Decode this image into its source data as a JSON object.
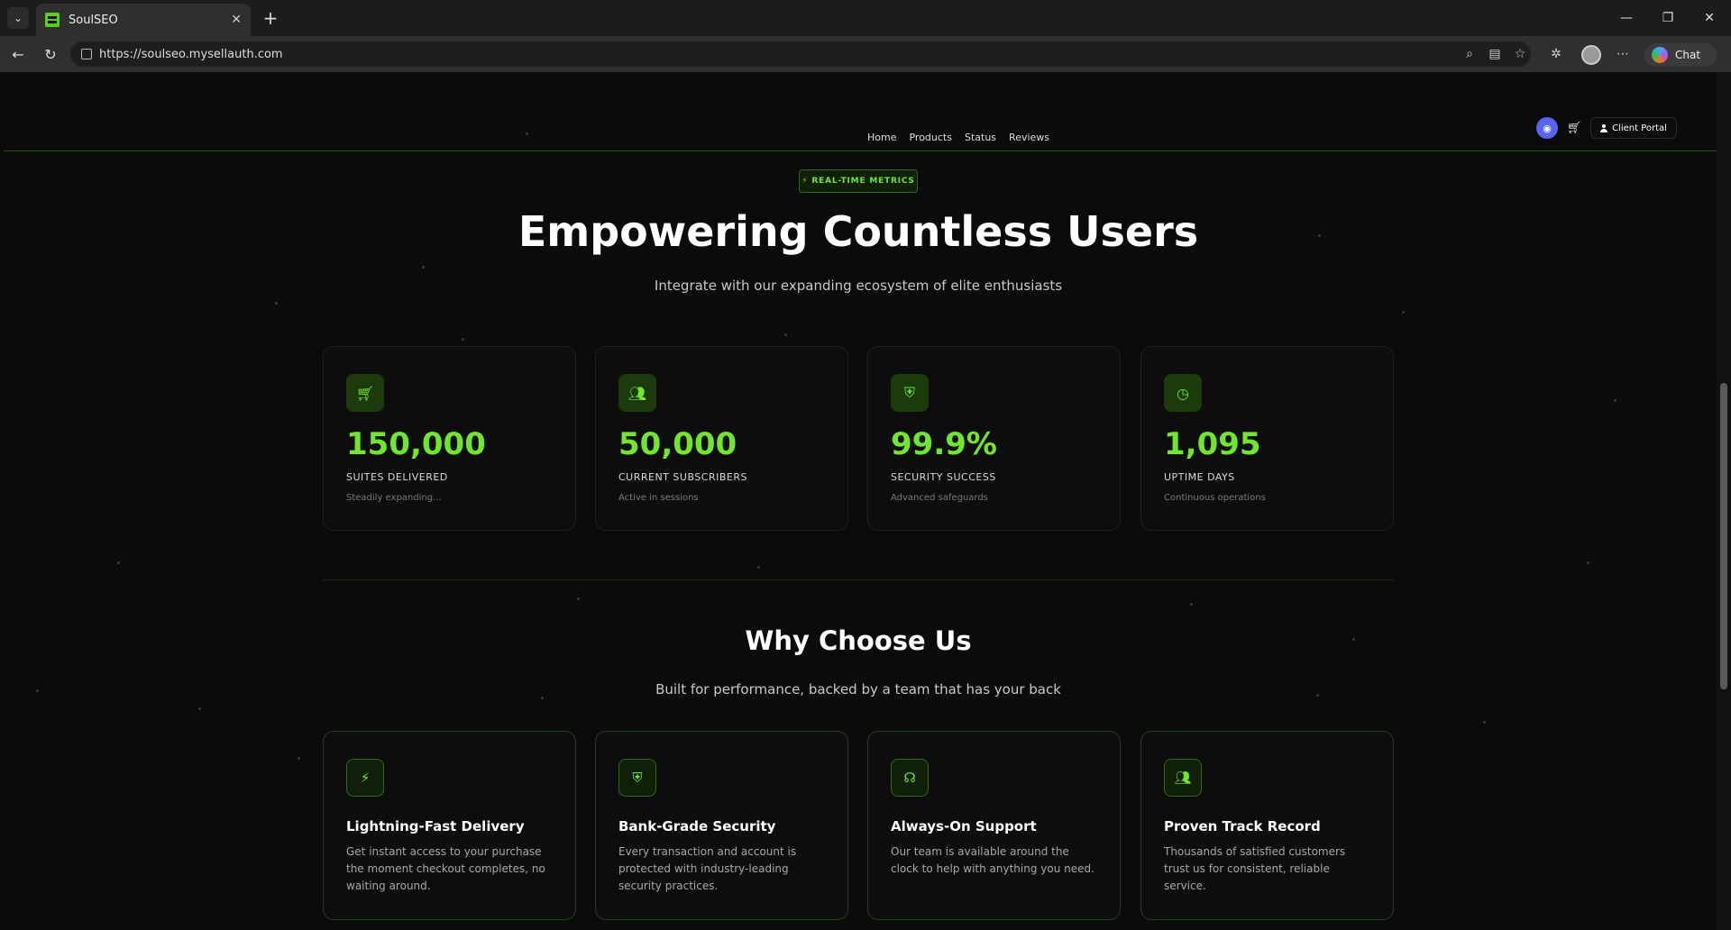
{
  "browser": {
    "tab_title": "SoulSEO",
    "url": "https://soulseo.mysellauth.com",
    "chat_label": "Chat"
  },
  "site": {
    "nav": [
      "Home",
      "Products",
      "Status",
      "Reviews"
    ],
    "portal_label": "Client Portal"
  },
  "hero": {
    "badge": "REAL-TIME METRICS",
    "title": "Empowering Countless Users",
    "subtitle": "Integrate with our expanding ecosystem of elite enthusiasts"
  },
  "stats": [
    {
      "icon": "cart-icon",
      "value": "150,000",
      "label": "SUITES DELIVERED",
      "desc": "Steadily expanding..."
    },
    {
      "icon": "users-icon",
      "value": "50,000",
      "label": "CURRENT SUBSCRIBERS",
      "desc": "Active in sessions"
    },
    {
      "icon": "shield-icon",
      "value": "99.9%",
      "label": "SECURITY SUCCESS",
      "desc": "Advanced safeguards"
    },
    {
      "icon": "clock-icon",
      "value": "1,095",
      "label": "UPTIME DAYS",
      "desc": "Continuous operations"
    }
  ],
  "why": {
    "title": "Why Choose Us",
    "subtitle": "Built for performance, backed by a team that has your back"
  },
  "features": [
    {
      "icon": "bolt-icon",
      "title": "Lightning-Fast Delivery",
      "desc": "Get instant access to your purchase the moment checkout completes, no waiting around."
    },
    {
      "icon": "shield-icon",
      "title": "Bank-Grade Security",
      "desc": "Every transaction and account is protected with industry-leading security practices."
    },
    {
      "icon": "headset-icon",
      "title": "Always-On Support",
      "desc": "Our team is available around the clock to help with anything you need."
    },
    {
      "icon": "users-icon",
      "title": "Proven Track Record",
      "desc": "Thousands of satisfied customers trust us for consistent, reliable service."
    }
  ],
  "colors": {
    "accent": "#6fe82a",
    "background": "#0b0b0b"
  }
}
